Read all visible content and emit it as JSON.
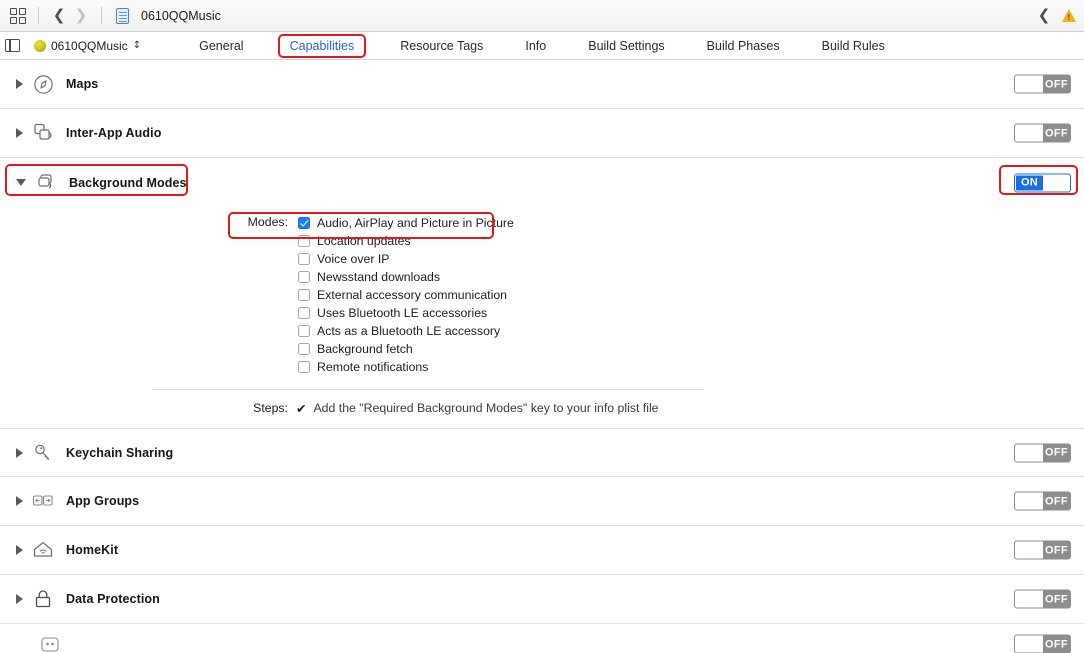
{
  "toolbar": {
    "grid_icon": "grid-icon",
    "back_icon": "chevron-left-icon",
    "forward_icon": "chevron-right-icon",
    "file_icon": "document-icon",
    "breadcrumb": "0610QQMusic",
    "right_chevron_icon": "chevron-left-icon",
    "warning_icon": "warning-triangle-icon"
  },
  "editor": {
    "panel_toggle_icon": "panel-toggle-icon",
    "app_icon": "app-circle-icon",
    "project_name": "0610QQMusic",
    "project_chevron": "⌃⌄",
    "tabs": [
      {
        "label": "General",
        "active": false,
        "highlighted": false
      },
      {
        "label": "Capabilities",
        "active": true,
        "highlighted": true
      },
      {
        "label": "Resource Tags",
        "active": false,
        "highlighted": false
      },
      {
        "label": "Info",
        "active": false,
        "highlighted": false
      },
      {
        "label": "Build Settings",
        "active": false,
        "highlighted": false
      },
      {
        "label": "Build Phases",
        "active": false,
        "highlighted": false
      },
      {
        "label": "Build Rules",
        "active": false,
        "highlighted": false
      }
    ]
  },
  "capabilities": [
    {
      "label": "Maps",
      "icon": "compass-icon",
      "toggle": "OFF",
      "expanded": false,
      "highlighted": false
    },
    {
      "label": "Inter-App Audio",
      "icon": "inter-app-audio-icon",
      "toggle": "OFF",
      "expanded": false,
      "highlighted": false
    },
    {
      "label": "Background Modes",
      "icon": "background-modes-icon",
      "toggle": "ON",
      "expanded": true,
      "highlighted": true
    },
    {
      "label": "Keychain Sharing",
      "icon": "key-icon",
      "toggle": "OFF",
      "expanded": false,
      "highlighted": false
    },
    {
      "label": "App Groups",
      "icon": "app-groups-icon",
      "toggle": "OFF",
      "expanded": false,
      "highlighted": false
    },
    {
      "label": "HomeKit",
      "icon": "house-icon",
      "toggle": "OFF",
      "expanded": false,
      "highlighted": false
    },
    {
      "label": "Data Protection",
      "icon": "lock-icon",
      "toggle": "OFF",
      "expanded": false,
      "highlighted": false
    }
  ],
  "background_modes": {
    "modes_label": "Modes:",
    "modes": [
      {
        "label": "Audio, AirPlay and Picture in Picture",
        "checked": true,
        "highlighted": true
      },
      {
        "label": "Location updates",
        "checked": false,
        "highlighted": false
      },
      {
        "label": "Voice over IP",
        "checked": false,
        "highlighted": false
      },
      {
        "label": "Newsstand downloads",
        "checked": false,
        "highlighted": false
      },
      {
        "label": "External accessory communication",
        "checked": false,
        "highlighted": false
      },
      {
        "label": "Uses Bluetooth LE accessories",
        "checked": false,
        "highlighted": false
      },
      {
        "label": "Acts as a Bluetooth LE accessory",
        "checked": false,
        "highlighted": false
      },
      {
        "label": "Background fetch",
        "checked": false,
        "highlighted": false
      },
      {
        "label": "Remote notifications",
        "checked": false,
        "highlighted": false
      }
    ],
    "steps_label": "Steps:",
    "steps_check": "✔",
    "steps_text": "Add the \"Required Background Modes\" key to your info plist file"
  },
  "toggle_labels": {
    "on": "ON",
    "off": "OFF"
  },
  "colors": {
    "highlight": "#e01b1b",
    "accent_blue": "#1a6fe0",
    "tab_active": "#2566c8",
    "toggle_off_track": "#8d8d8d",
    "checkbox_checked": "#1a7ef5",
    "warning": "#f0b217"
  }
}
